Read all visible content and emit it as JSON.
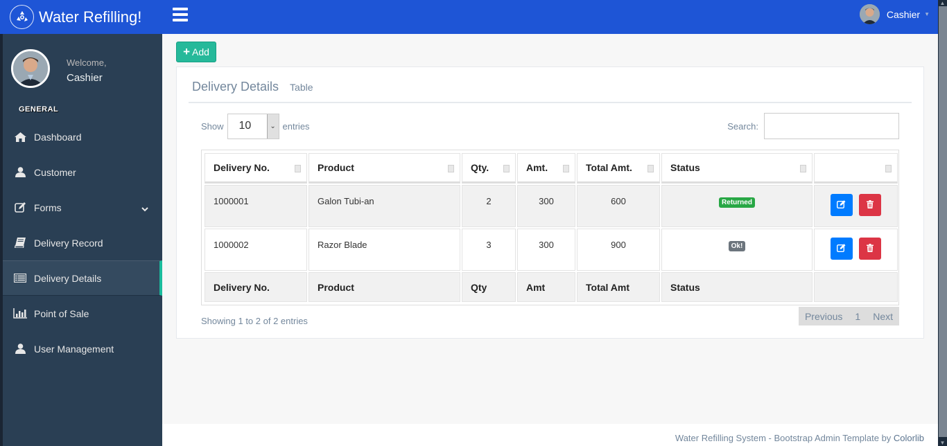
{
  "brand": {
    "title": "Water Refilling!",
    "logo_icon": "recycle-icon"
  },
  "topbar": {
    "user_name": "Cashier"
  },
  "sidebar": {
    "welcome": "Welcome,",
    "user_name": "Cashier",
    "section_title": "GENERAL",
    "items": [
      {
        "label": "Dashboard",
        "icon": "home-icon"
      },
      {
        "label": "Customer",
        "icon": "user-icon"
      },
      {
        "label": "Forms",
        "icon": "edit-icon",
        "has_submenu": true
      },
      {
        "label": "Delivery Record",
        "icon": "book-icon"
      },
      {
        "label": "Delivery Details",
        "icon": "list-icon",
        "active": true
      },
      {
        "label": "Point of Sale",
        "icon": "bar-chart-icon"
      },
      {
        "label": "User Management",
        "icon": "user-icon"
      }
    ]
  },
  "main": {
    "add_button": "Add",
    "panel": {
      "title": "Delivery Details",
      "subtitle": "Table"
    },
    "length": {
      "show": "Show",
      "value": "10",
      "entries": "entries"
    },
    "search": {
      "label": "Search:",
      "value": ""
    },
    "table": {
      "headers": [
        "Delivery No.",
        "Product",
        "Qty.",
        "Amt.",
        "Total Amt.",
        "Status",
        ""
      ],
      "footers": [
        "Delivery No.",
        "Product",
        "Qty",
        "Amt",
        "Total Amt",
        "Status",
        ""
      ],
      "rows": [
        {
          "delivery_no": "1000001",
          "product": "Galon Tubi-an",
          "qty": "2",
          "amt": "300",
          "total": "600",
          "status": "Returned",
          "status_color": "#28A745"
        },
        {
          "delivery_no": "1000002",
          "product": "Razor Blade",
          "qty": "3",
          "amt": "300",
          "total": "900",
          "status": "Ok!",
          "status_color": "#6C757D"
        }
      ]
    },
    "info": "Showing 1 to 2 of 2 entries",
    "pagination": {
      "previous": "Previous",
      "page": "1",
      "next": "Next"
    }
  },
  "footer": {
    "text": "Water Refilling System - Bootstrap Admin Template by ",
    "link": "Colorlib"
  },
  "colors": {
    "topbar": "#1E55D6",
    "sidebar": "#2A3F54",
    "accent": "#1ABB9C",
    "add": "#26B99A",
    "edit": "#007BFF",
    "delete": "#DC3545"
  }
}
